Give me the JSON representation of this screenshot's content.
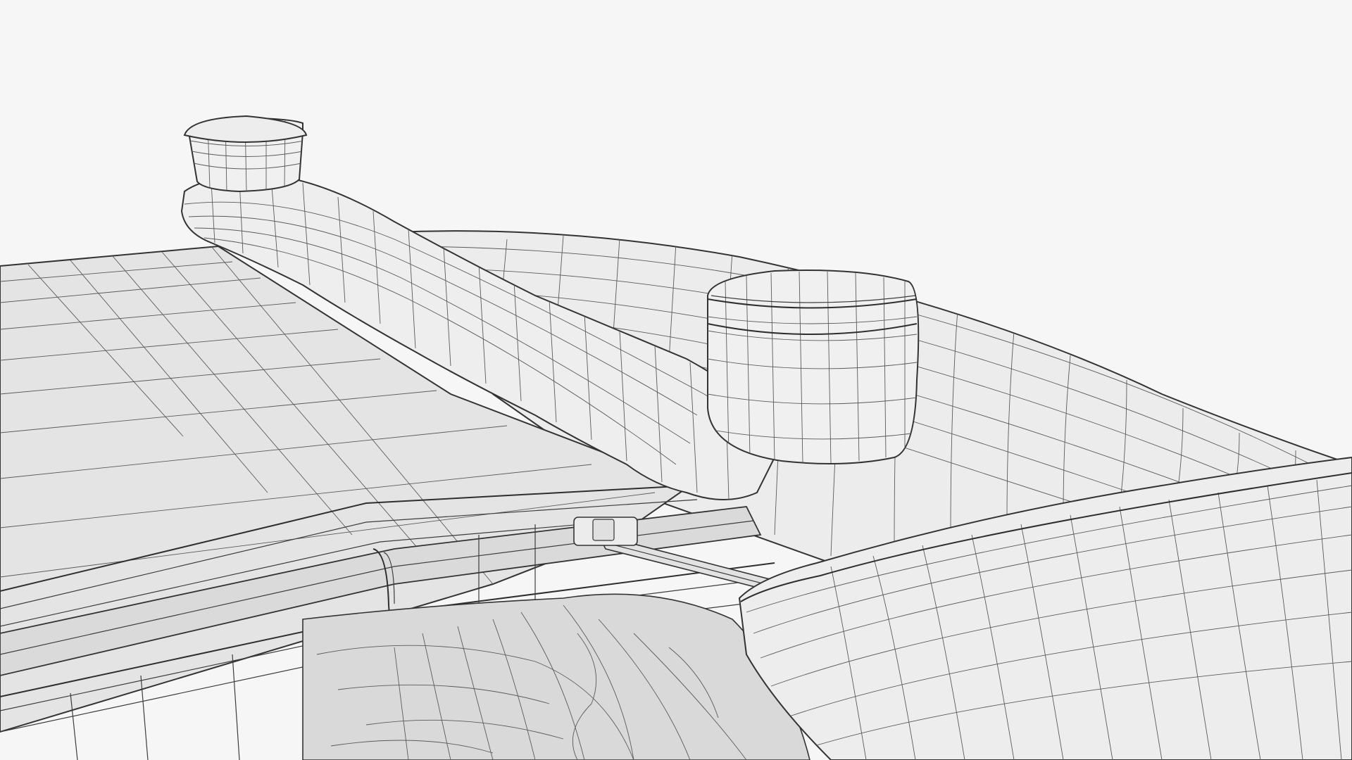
{
  "scene": {
    "subject": "wireframe-render",
    "background_color": "#f6f6f6",
    "surface_color": "#e8e8e8",
    "surface_shade_color": "#d7d7d7",
    "wire_color": "#3c3c3c",
    "cavity_color": "#cfcfcf"
  }
}
